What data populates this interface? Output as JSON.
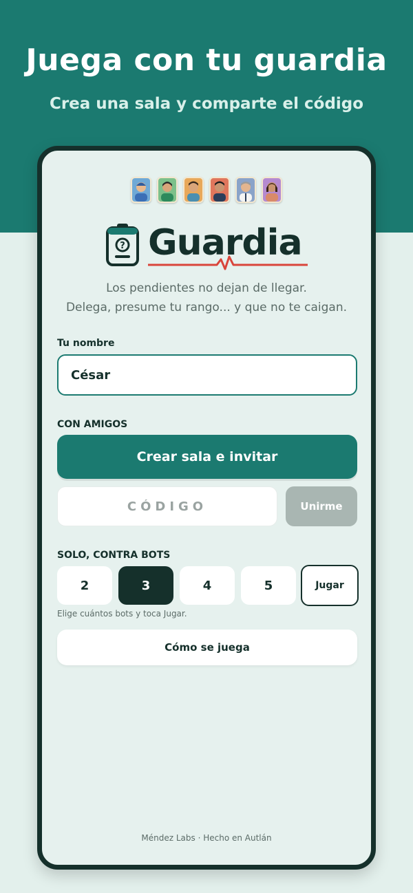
{
  "hero": {
    "title": "Juega con tu guardia",
    "subtitle": "Crea una sala y comparte el código"
  },
  "app": {
    "logo_text": "Guardia",
    "tagline_line1": "Los pendientes no dejan de llegar.",
    "tagline_line2": "Delega, presume tu rango... y que no te caigan.",
    "avatars": [
      {
        "name": "doctor-avatar-1",
        "bg": "#6fa9d6"
      },
      {
        "name": "doctor-avatar-2",
        "bg": "#7cc08a"
      },
      {
        "name": "doctor-avatar-3",
        "bg": "#e8a85a"
      },
      {
        "name": "doctor-avatar-4",
        "bg": "#e0765c"
      },
      {
        "name": "doctor-avatar-5",
        "bg": "#8aa3c9"
      },
      {
        "name": "doctor-avatar-6",
        "bg": "#b58ad0"
      }
    ]
  },
  "name_section": {
    "label": "Tu nombre",
    "value": "César"
  },
  "friends_section": {
    "label": "CON AMIGOS",
    "create_button": "Crear sala e invitar",
    "code_placeholder": "CÓDIGO",
    "join_button": "Unirme"
  },
  "bots_section": {
    "label": "SOLO, CONTRA BOTS",
    "options": [
      "2",
      "3",
      "4",
      "5"
    ],
    "selected": "3",
    "play_button": "Jugar",
    "hint": "Elige cuántos bots y toca Jugar."
  },
  "how_to_play_button": "Cómo se juega",
  "footer": "Méndez Labs · Hecho en Autlán",
  "colors": {
    "primary": "#1b7a70",
    "dark": "#15302b",
    "accent_red": "#d9453b",
    "disabled": "#a9b6b2",
    "background": "#e3f0ec"
  }
}
